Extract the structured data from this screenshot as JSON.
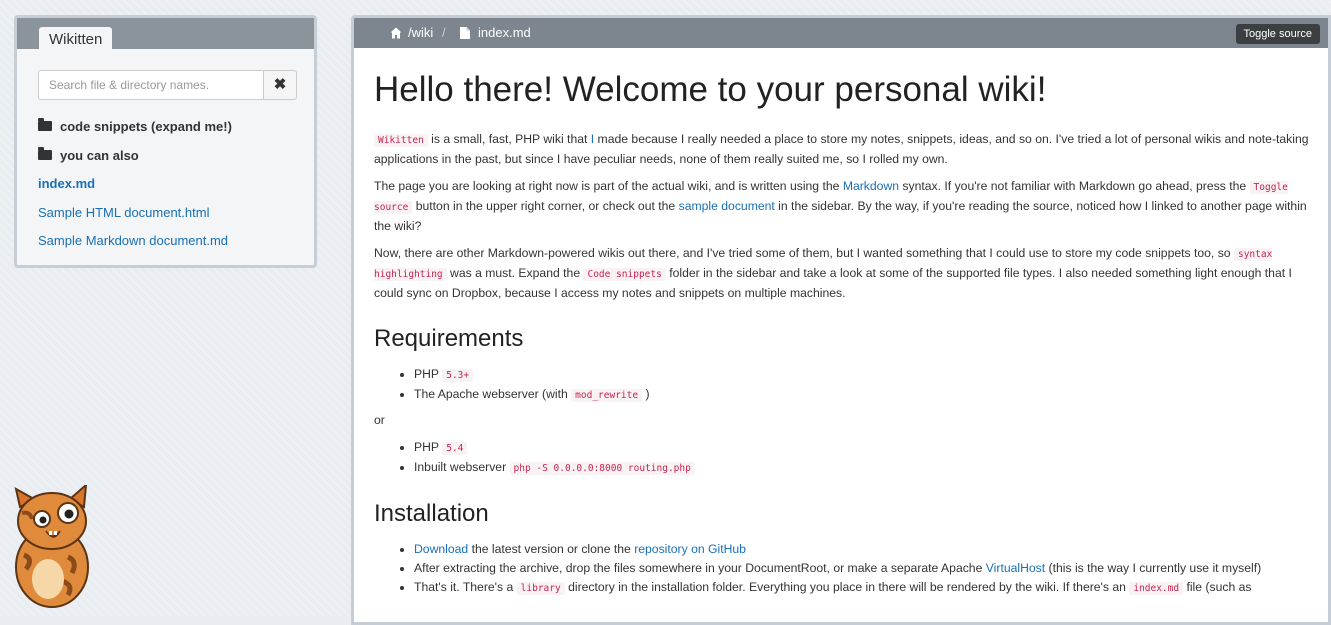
{
  "sidebar": {
    "title": "Wikitten",
    "search": {
      "placeholder": "Search file & directory names.",
      "value": "",
      "clear": "✖"
    },
    "items": [
      {
        "label": "code snippets (expand me!)",
        "type": "folder"
      },
      {
        "label": "you can also",
        "type": "folder"
      },
      {
        "label": "index.md",
        "type": "active"
      },
      {
        "label": "Sample HTML document.html",
        "type": "link"
      },
      {
        "label": "Sample Markdown document.md",
        "type": "link"
      }
    ]
  },
  "topbar": {
    "crumb_wiki": "/wiki",
    "separator": "/",
    "crumb_file": "index.md",
    "toggle_label": "Toggle source"
  },
  "content": {
    "h1": "Hello there! Welcome to your personal wiki!",
    "p1": {
      "code": "Wikitten",
      "t1": " is a small, fast, PHP wiki that ",
      "link": "I",
      "t2": " made because I really needed a place to store my notes, snippets, ideas, and so on. I've tried a lot of personal wikis and note-taking applications in the past, but since I have peculiar needs, none of them really suited me, so I rolled my own."
    },
    "p2": {
      "t1": "The page you are looking at right now is part of the actual wiki, and is written using the ",
      "link1": "Markdown",
      "t2": " syntax. If you're not familiar with Markdown go ahead, press the ",
      "code": "Toggle source",
      "t3": " button in the upper right corner, or check out the ",
      "link2": "sample document",
      "t4": " in the sidebar. By the way, if you're reading the source, noticed how I linked to another page within the wiki?"
    },
    "p3": {
      "t1": "Now, there are other Markdown-powered wikis out there, and I've tried some of them, but I wanted something that I could use to store my code snippets too, so ",
      "code1": "syntax highlighting",
      "t2": " was a must. Expand the ",
      "code2": "Code snippets",
      "t3": " folder in the sidebar and take a look at some of the supported file types. I also needed something light enough that I could sync on Dropbox, because I access my notes and snippets on multiple machines."
    },
    "h2_requirements": "Requirements",
    "req_list1": [
      {
        "text": "PHP ",
        "code": "5.3+",
        "suffix": ""
      },
      {
        "text": "The Apache webserver (with ",
        "code": "mod_rewrite",
        "suffix": " )"
      }
    ],
    "or": "or",
    "req_list2": [
      {
        "text": "PHP ",
        "code": "5.4"
      },
      {
        "text": "Inbuilt webserver ",
        "code": "php -S 0.0.0.0:8000 routing.php"
      }
    ],
    "h2_installation": "Installation",
    "install": {
      "i1_link1": "Download",
      "i1_t1": " the latest version or clone the ",
      "i1_link2": "repository on GitHub",
      "i2_t1": "After extracting the archive, drop the files somewhere in your DocumentRoot, or make a separate Apache ",
      "i2_link": "VirtualHost",
      "i2_t2": " (this is the way I currently use it myself)",
      "i3_t1": "That's it. There's a ",
      "i3_code1": "library",
      "i3_t2": " directory in the installation folder. Everything you place in there will be rendered by the wiki. If there's an ",
      "i3_code2": "index.md",
      "i3_t3": " file (such as"
    }
  },
  "colors": {
    "link": "#1a6fb5",
    "code_text": "#c7254e",
    "code_bg": "#f9f2f4",
    "topbar_bg": "#7d858e",
    "toggle_bg": "#3c3f42"
  },
  "icons": [
    "folder-icon",
    "home-icon",
    "file-icon",
    "close-icon",
    "cat-mascot"
  ]
}
